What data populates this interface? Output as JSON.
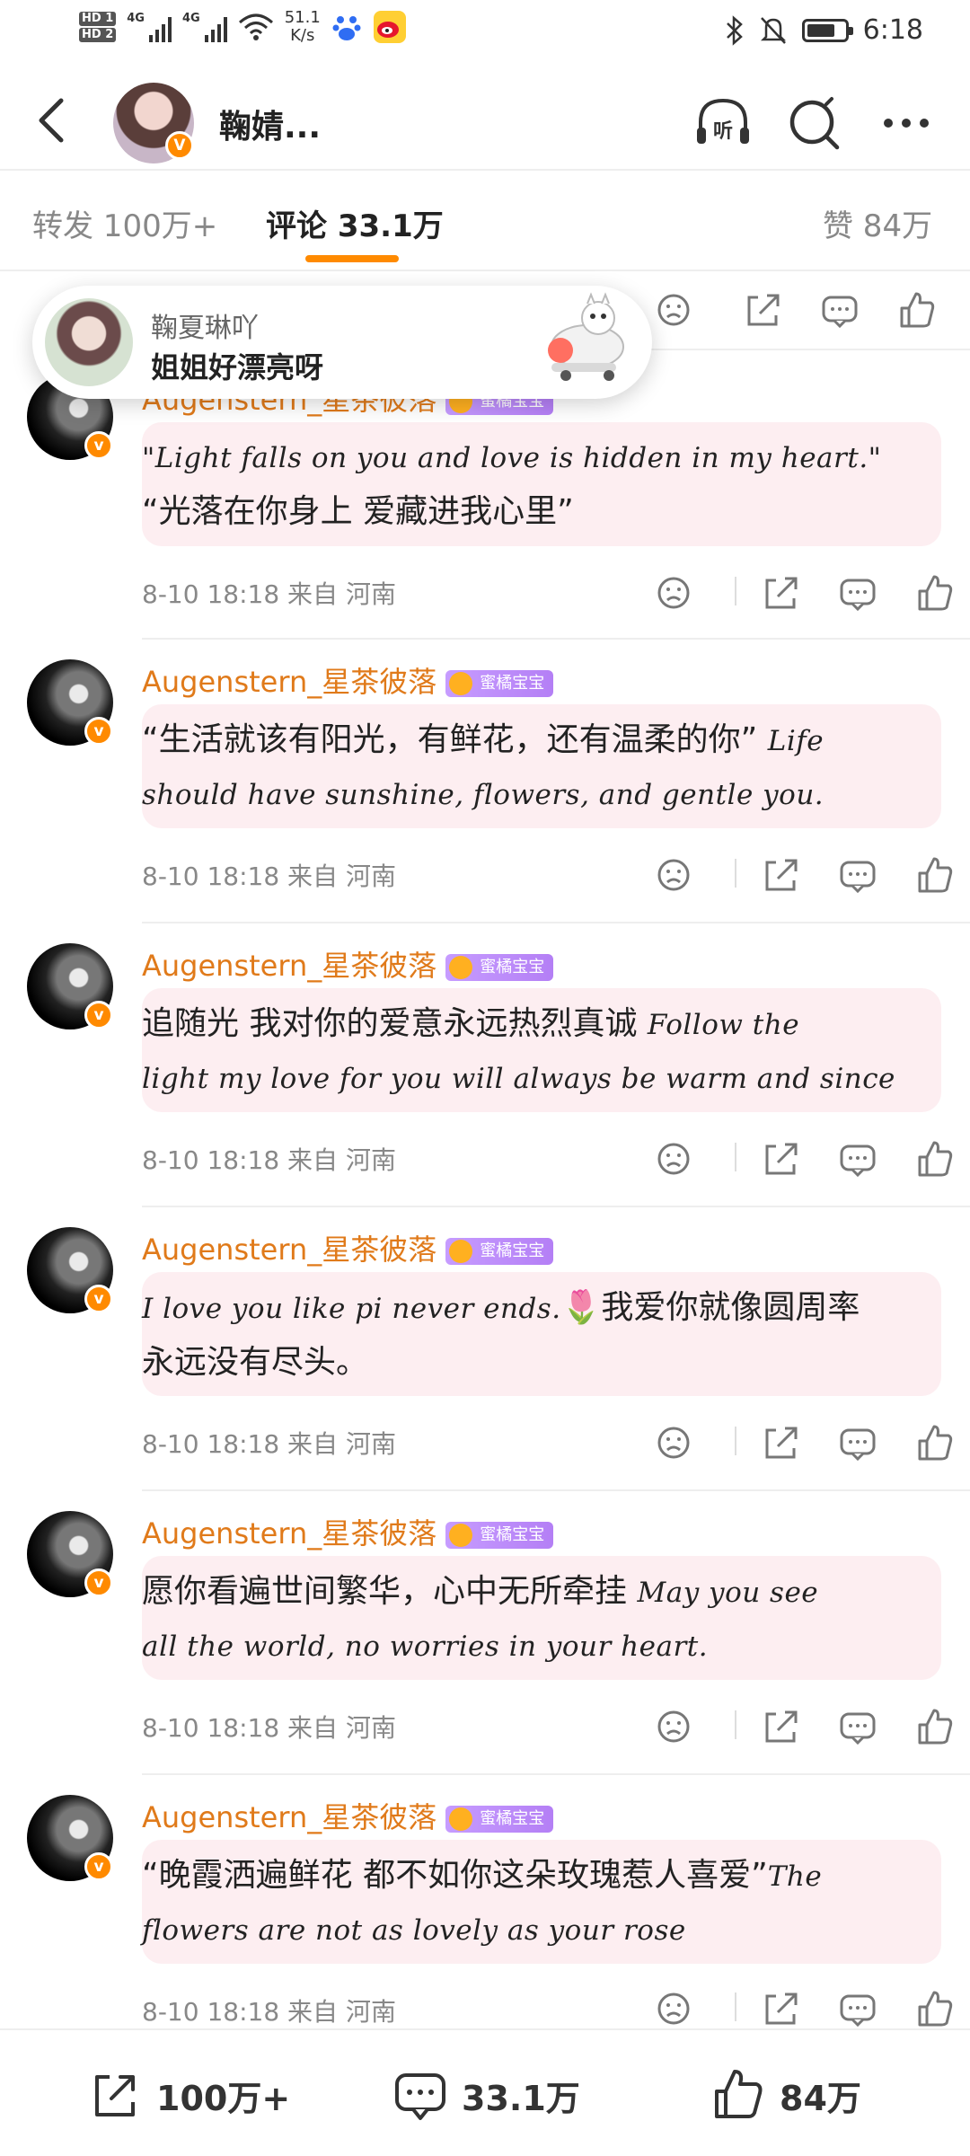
{
  "status_bar": {
    "hd1": "HD 1",
    "hd2": "HD 2",
    "signal1_label": "4G",
    "signal2_label": "4G",
    "speed_value": "51.1",
    "speed_unit": "K/s",
    "time": "6:18"
  },
  "header": {
    "title": "鞠婧..."
  },
  "tabs": [
    {
      "label": "转发 100万+"
    },
    {
      "label": "评论 33.1万"
    },
    {
      "label": "赞 84万"
    }
  ],
  "popup": {
    "name": "鞠夏琳吖",
    "message": "姐姐好漂亮呀"
  },
  "comments": [
    {
      "name": "Augenstern_星茶彼落",
      "vip": "蜜橘宝宝",
      "line1": "\"Light falls on you and love is hidden in my heart.\"",
      "line2": "“光落在你身上 爱藏进我心里”",
      "time": "8-10 18:18",
      "location": "来自 河南"
    },
    {
      "name": "Augenstern_星茶彼落",
      "vip": "蜜橘宝宝",
      "line1_cn": "“生活就该有阳光，有鲜花，还有温柔的你”",
      "line1_en": "Life",
      "line2": "should have sunshine, flowers, and gentle you.",
      "time": "8-10 18:18",
      "location": "来自 河南"
    },
    {
      "name": "Augenstern_星茶彼落",
      "vip": "蜜橘宝宝",
      "line1_cn": "追随光 我对你的爱意永远热烈真诚",
      "line1_en": "Follow the",
      "line2": "light my love for you will always be warm and since",
      "time": "8-10 18:18",
      "location": "来自 河南"
    },
    {
      "name": "Augenstern_星茶彼落",
      "vip": "蜜橘宝宝",
      "line1_en": "I love you like pi never ends.",
      "line1_emoji": "🌷",
      "line1_cn": "我爱你就像圆周率",
      "line2": "永远没有尽头。",
      "time": "8-10 18:18",
      "location": "来自 河南"
    },
    {
      "name": "Augenstern_星茶彼落",
      "vip": "蜜橘宝宝",
      "line1_cn": "愿你看遍世间繁华，心中无所牵挂",
      "line1_en": "May you see",
      "line2": "all the world, no worries in your heart.",
      "time": "8-10 18:18",
      "location": "来自 河南"
    },
    {
      "name": "Augenstern_星茶彼落",
      "vip": "蜜橘宝宝",
      "line1_cn": "“晚霞洒遍鲜花 都不如你这朵玫瑰惹人喜爱”",
      "line1_en": "The",
      "line2": "flowers are not as lovely as your rose",
      "time": "8-10 18:18",
      "location": "来自 河南"
    }
  ],
  "bottom_bar": {
    "repost": "100万+",
    "comment": "33.1万",
    "like": "84万"
  },
  "colors": {
    "accent": "#ff8a00",
    "username": "#e07a1a",
    "bubble": "#fdeef1"
  }
}
